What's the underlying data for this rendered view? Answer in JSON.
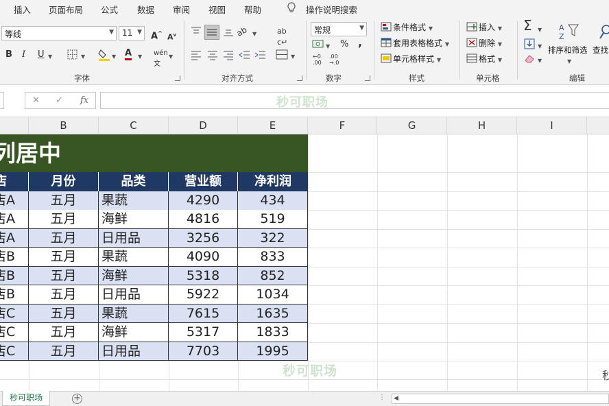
{
  "ribbon_tabs": [
    "插入",
    "页面布局",
    "公式",
    "数据",
    "审阅",
    "视图",
    "帮助"
  ],
  "search_tell": "操作说明搜索",
  "font_group": {
    "font_name": "等线",
    "font_size": "11",
    "bold": "B",
    "italic": "I",
    "underline": "U",
    "label": "字体"
  },
  "align_group": {
    "label": "对齐方式"
  },
  "number_group": {
    "format": "常规",
    "percent": "%",
    "comma": ",",
    "label": "数字"
  },
  "styles_group": {
    "conditional": "条件格式",
    "table": "套用表格格式",
    "cell_styles": "单元格样式",
    "label": "样式"
  },
  "cells_group": {
    "insert": "插入",
    "delete": "删除",
    "format": "格式",
    "label": "单元格"
  },
  "editing_group": {
    "sort_filter": "排序和筛选",
    "find": "查找",
    "label": "编辑"
  },
  "formula_bar": {
    "watermark": "秒可职场"
  },
  "columns": [
    "B",
    "C",
    "D",
    "E",
    "F",
    "G",
    "H",
    "I"
  ],
  "sheet": {
    "title": "列居中",
    "headers": [
      "店",
      "月份",
      "品类",
      "营业额",
      "净利润"
    ],
    "rows": [
      [
        "店A",
        "五月",
        "果蔬",
        "4290",
        "434"
      ],
      [
        "店A",
        "五月",
        "海鲜",
        "4816",
        "519"
      ],
      [
        "店A",
        "五月",
        "日用品",
        "3256",
        "322"
      ],
      [
        "店B",
        "五月",
        "果蔬",
        "4090",
        "833"
      ],
      [
        "店B",
        "五月",
        "海鲜",
        "5318",
        "852"
      ],
      [
        "店B",
        "五月",
        "日用品",
        "5922",
        "1034"
      ],
      [
        "店C",
        "五月",
        "果蔬",
        "7615",
        "1635"
      ],
      [
        "店C",
        "五月",
        "海鲜",
        "5317",
        "1833"
      ],
      [
        "店C",
        "五月",
        "日用品",
        "7703",
        "1995"
      ]
    ],
    "watermark": "秒可职场",
    "corner_watermark": "秒"
  },
  "sheet_tabs": {
    "active": "秒可职场",
    "add": "+"
  },
  "colors": {
    "title_band": "#375623",
    "header_row": "#1f3864",
    "band_a": "#d9e1f2",
    "band_b": "#ffffff",
    "accent": "#217346"
  }
}
